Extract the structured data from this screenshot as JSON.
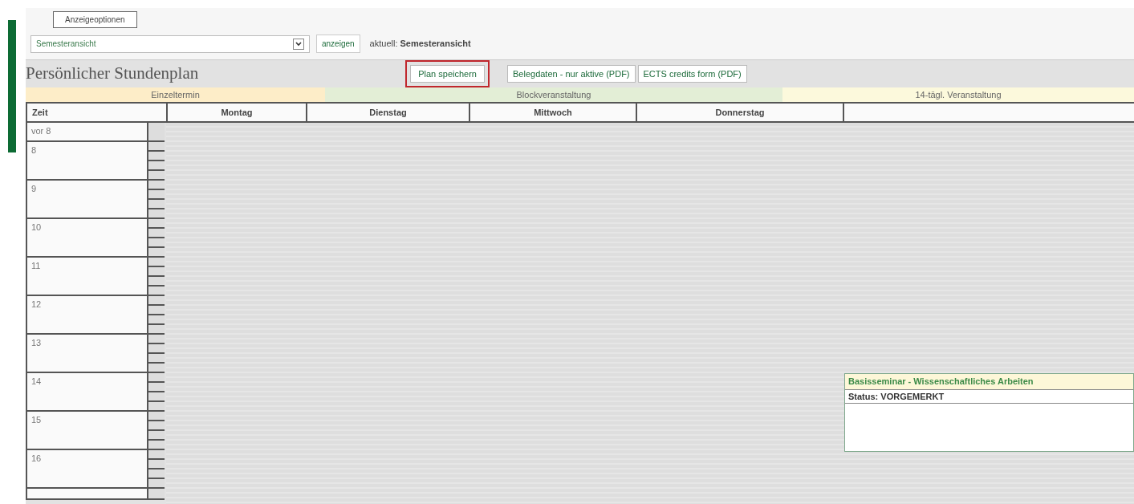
{
  "options": {
    "legend": "Anzeigeoptionen",
    "view_select": {
      "value": "Semesteransicht"
    },
    "show_button": "anzeigen",
    "current_label": "aktuell:",
    "current_value": "Semesteransicht"
  },
  "title": "Persönlicher Stundenplan",
  "actions": [
    {
      "label": "Plan speichern",
      "highlighted": true
    },
    {
      "label": "Belegdaten - nur aktive (PDF)",
      "highlighted": false
    },
    {
      "label": "ECTS credits form (PDF)",
      "highlighted": false
    }
  ],
  "legend": [
    {
      "label": "Einzeltermin",
      "color": "#fdedc8"
    },
    {
      "label": "Blockveranstaltung",
      "color": "#e3eed6"
    },
    {
      "label": "14-tägl. Veranstaltung",
      "color": "#fcf9dc"
    }
  ],
  "table": {
    "columns": [
      "Zeit",
      "Montag",
      "Dienstag",
      "Mittwoch",
      "Donnerstag"
    ],
    "rows": [
      {
        "label": "vor 8",
        "kind": "short"
      },
      {
        "label": "8",
        "kind": "hour"
      },
      {
        "label": "9",
        "kind": "hour"
      },
      {
        "label": "10",
        "kind": "hour"
      },
      {
        "label": "11",
        "kind": "hour"
      },
      {
        "label": "12",
        "kind": "hour"
      },
      {
        "label": "13",
        "kind": "hour"
      },
      {
        "label": "14",
        "kind": "hour",
        "events": [
          {
            "title": "Basisseminar - Wissenschaftliches Arbeiten",
            "status": "Status: VORGEMERKT"
          }
        ]
      },
      {
        "label": "15",
        "kind": "hour"
      },
      {
        "label": "16",
        "kind": "hour"
      }
    ]
  }
}
